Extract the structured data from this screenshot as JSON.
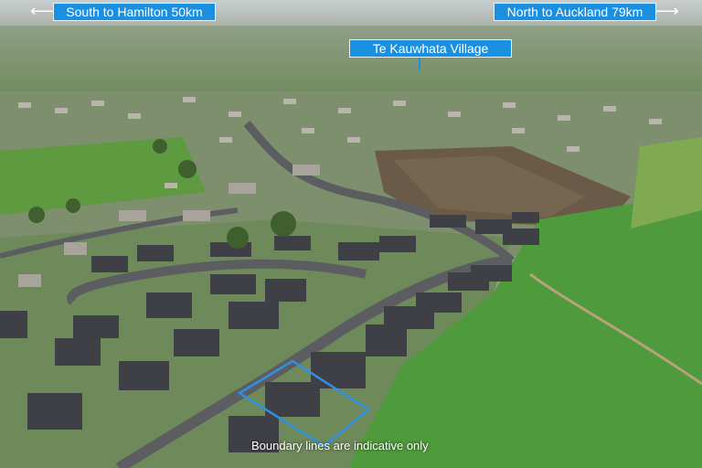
{
  "labels": {
    "south": "South to Hamilton 50km",
    "north": "North to Auckland 79km",
    "village": "Te Kauwhata Village",
    "disclaimer": "Boundary lines are indicative only"
  },
  "colors": {
    "label_bg": "#1b8fe0",
    "boundary": "#2f8fe6",
    "pasture": "#4f9a3c",
    "road": "#5b5d60"
  },
  "icons": {
    "south_arrow": "arrow-left-icon",
    "north_arrow": "arrow-right-icon"
  }
}
